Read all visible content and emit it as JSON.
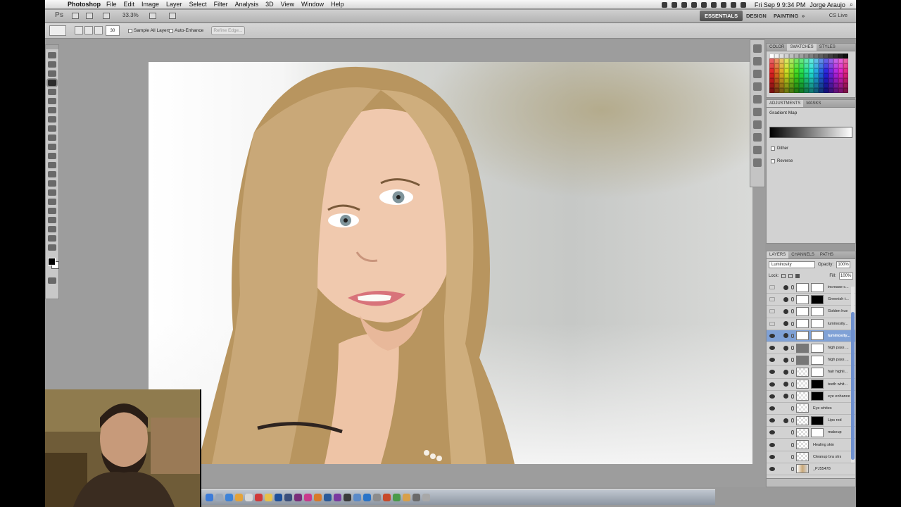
{
  "menubar": {
    "app_name": "Photoshop",
    "items": [
      "File",
      "Edit",
      "Image",
      "Layer",
      "Select",
      "Filter",
      "Analysis",
      "3D",
      "View",
      "Window",
      "Help"
    ],
    "clock": "Fri Sep 9  9:34 PM",
    "user": "Jorge Araujo"
  },
  "appbar": {
    "logo": "Ps",
    "zoom": "33.3%",
    "workspaces": [
      "ESSENTIALS",
      "DESIGN",
      "PAINTING"
    ],
    "active_workspace": "ESSENTIALS",
    "more": "»",
    "cs_live": "CS Live"
  },
  "options_bar": {
    "brush_size": "30",
    "sample_all_layers": "Sample All Layers",
    "auto_enhance": "Auto-Enhance",
    "refine_edge": "Refine Edge..."
  },
  "panels": {
    "color_tabs": [
      "COLOR",
      "SWATCHES",
      "STYLES"
    ],
    "active_color_tab": "SWATCHES",
    "adjustment_tabs": [
      "ADJUSTMENTS",
      "MASKS"
    ],
    "adjustment_title": "Gradient Map",
    "dither_label": "Dither",
    "reverse_label": "Reverse",
    "layer_tabs": [
      "LAYERS",
      "CHANNELS",
      "PATHS"
    ],
    "blend_mode": "Luminosity",
    "opacity_label": "Opacity:",
    "opacity_value": "100%",
    "lock_label": "Lock:",
    "fill_label": "Fill:",
    "fill_value": "100%"
  },
  "layers": [
    {
      "name": "increase c...",
      "visible": false,
      "selected": false
    },
    {
      "name": "Greenish t...",
      "visible": false,
      "selected": false
    },
    {
      "name": "Golden hue",
      "visible": false,
      "selected": false
    },
    {
      "name": "luminosity...",
      "visible": false,
      "selected": false
    },
    {
      "name": "luminosity...",
      "visible": true,
      "selected": true
    },
    {
      "name": "high pass ...",
      "visible": true,
      "selected": false
    },
    {
      "name": "high pass ...",
      "visible": true,
      "selected": false
    },
    {
      "name": "hair highli...",
      "visible": true,
      "selected": false
    },
    {
      "name": "teeth whit...",
      "visible": true,
      "selected": false
    },
    {
      "name": "eye enhance",
      "visible": true,
      "selected": false
    },
    {
      "name": "Eye whites",
      "visible": true,
      "selected": false
    },
    {
      "name": "Lips red",
      "visible": true,
      "selected": false
    },
    {
      "name": "makeup",
      "visible": true,
      "selected": false
    },
    {
      "name": "Healing skin",
      "visible": true,
      "selected": false
    },
    {
      "name": "Cleanup bra strap",
      "visible": true,
      "selected": false
    },
    {
      "name": "_PJ55478",
      "visible": true,
      "selected": false
    }
  ],
  "colors": {
    "selection": "#7fa1d6",
    "active_workspace_bg": "#555555"
  }
}
